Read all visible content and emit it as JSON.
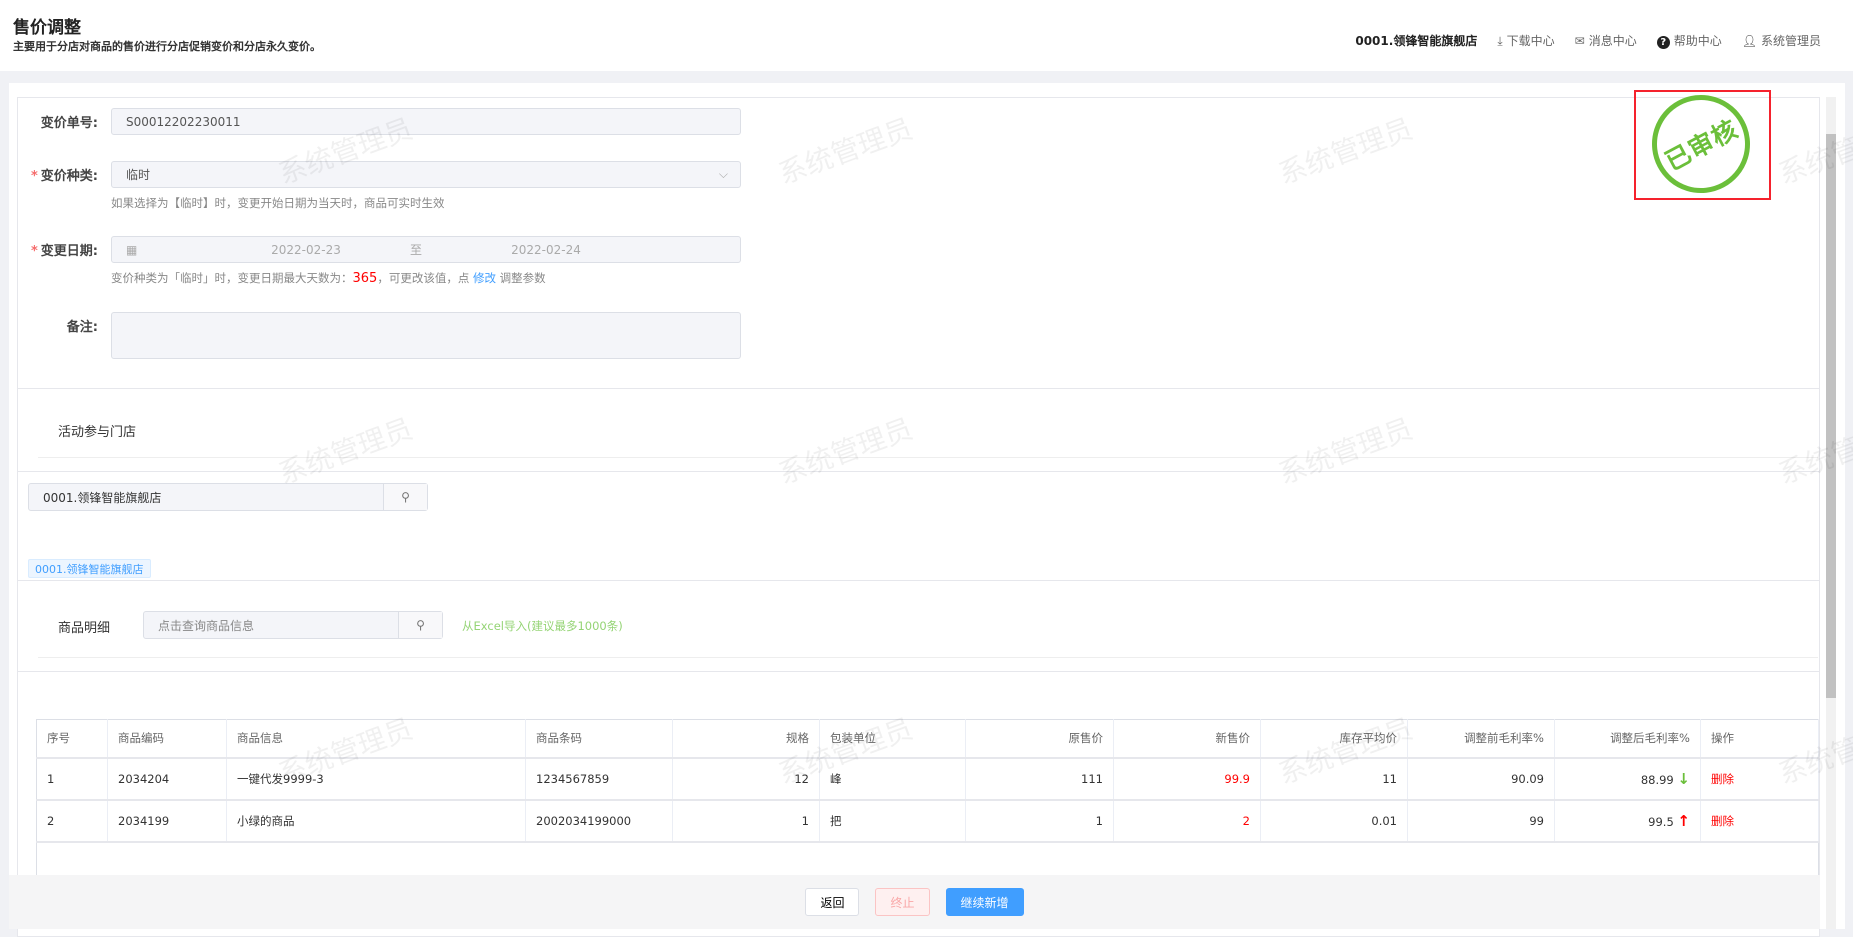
{
  "header": {
    "title": "售价调整",
    "subtitle": "主要用于分店对商品的售价进行分店促销变价和分店永久变价。",
    "store": "0001.领锋智能旗舰店",
    "download": "下载中心",
    "messages": "消息中心",
    "help": "帮助中心",
    "user": "系统管理员"
  },
  "form": {
    "order_no_label": "变价单号:",
    "order_no": "S00012202230011",
    "type_label": "变价种类:",
    "type_value": "临时",
    "type_hint": "如果选择为【临时】时，变更开始日期为当天时，商品可实时生效",
    "date_label": "变更日期:",
    "date_start": "2022-02-23",
    "date_sep": "至",
    "date_end": "2022-02-24",
    "date_hint_pre": "变价种类为「临时」时，变更日期最大天数为：",
    "date_hint_days": "365",
    "date_hint_mid": "，可更改该值，点 ",
    "date_hint_link": "修改",
    "date_hint_post": " 调整参数",
    "remark_label": "备注:",
    "remark": ""
  },
  "stores": {
    "title": "活动参与门店",
    "search_value": "0001.领锋智能旗舰店",
    "tag": "0001.领锋智能旗舰店"
  },
  "products": {
    "title": "商品明细",
    "search_placeholder": "点击查询商品信息",
    "import_link": "从Excel导入(建议最多1000条)"
  },
  "table": {
    "headers": [
      "序号",
      "商品编码",
      "商品信息",
      "商品条码",
      "规格",
      "包装单位",
      "原售价",
      "新售价",
      "库存平均价",
      "调整前毛利率%",
      "调整后毛利率%",
      "操作"
    ],
    "rows": [
      {
        "no": "1",
        "code": "2034204",
        "info": "一键代发9999-3",
        "barcode": "1234567859",
        "spec": "12",
        "unit": "峰",
        "orig": "111",
        "new": "99.9",
        "avg": "11",
        "before": "90.09",
        "after": "88.99",
        "trend": "down",
        "op": "删除"
      },
      {
        "no": "2",
        "code": "2034199",
        "info": "小绿的商品",
        "barcode": "2002034199000",
        "spec": "1",
        "unit": "把",
        "orig": "1",
        "new": "2",
        "avg": "0.01",
        "before": "99",
        "after": "99.5",
        "trend": "up",
        "op": "删除"
      }
    ]
  },
  "stamp": {
    "text": "已审核",
    "color": "#6bbf3a"
  },
  "watermark": "系统管理员",
  "footer": {
    "back": "返回",
    "stop": "终止",
    "continue": "继续新增"
  },
  "colors": {
    "primary": "#409eff",
    "danger": "#f00",
    "up": "#f00",
    "down": "#6bbf3a"
  }
}
